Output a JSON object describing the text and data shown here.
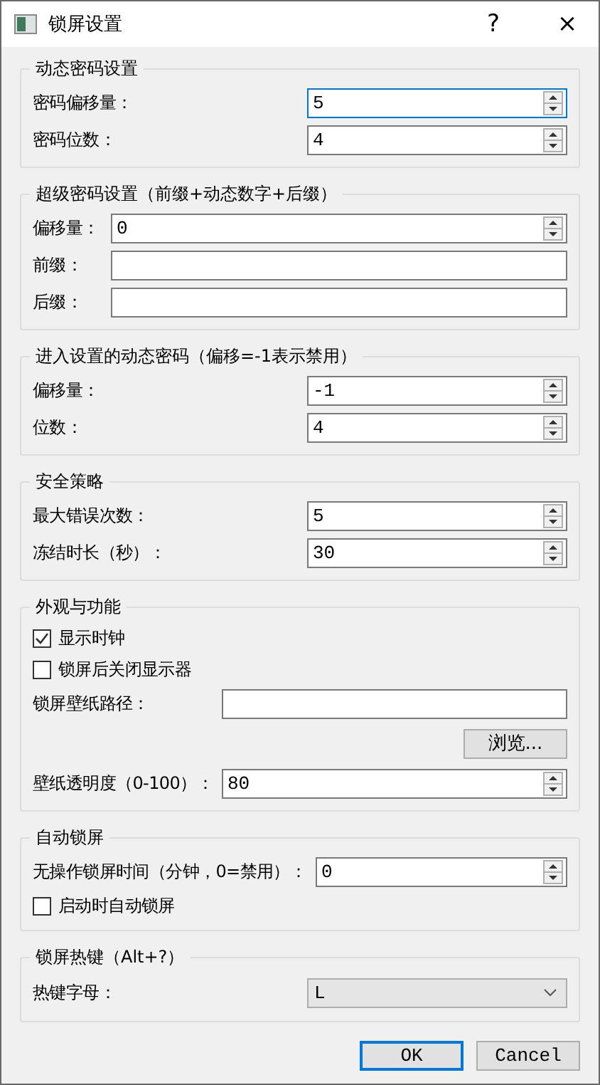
{
  "window": {
    "title": "锁屏设置",
    "help_button": "?",
    "close_button": "×"
  },
  "groups": [
    {
      "title": "动态密码设置",
      "rows": [
        {
          "kind": "spin",
          "label": "密码偏移量：",
          "value": "5",
          "focused": true
        },
        {
          "kind": "spin",
          "label": "密码位数：",
          "value": "4",
          "focused": false
        }
      ]
    },
    {
      "title": "超级密码设置（前缀+动态数字+后缀）",
      "rows": [
        {
          "kind": "spin",
          "label": "偏移量：",
          "value": "0",
          "focused": false
        },
        {
          "kind": "text",
          "label": "前缀："
        },
        {
          "kind": "text",
          "label": "后缀："
        }
      ]
    },
    {
      "title": "进入设置的动态密码（偏移=-1表示禁用）",
      "rows": [
        {
          "kind": "spin",
          "label": "偏移量：",
          "value": "-1",
          "focused": false
        },
        {
          "kind": "spin",
          "label": "位数：",
          "value": "4",
          "focused": false
        }
      ]
    },
    {
      "title": "安全策略",
      "rows": [
        {
          "kind": "spin",
          "label": "最大错误次数：",
          "value": "5",
          "focused": false
        },
        {
          "kind": "spin",
          "label": "冻结时长（秒）：",
          "value": "30",
          "focused": false
        }
      ]
    },
    {
      "title": "外观与功能",
      "rows": [
        {
          "kind": "checkbox",
          "label": "显示时钟",
          "checked": true
        },
        {
          "kind": "checkbox",
          "label": "锁屏后关闭显示器",
          "checked": false
        },
        {
          "kind": "text",
          "label": "锁屏壁纸路径："
        },
        {
          "kind": "button",
          "label": "浏览..."
        },
        {
          "kind": "spin",
          "label": "壁纸透明度（0-100）：",
          "value": "80",
          "focused": false
        }
      ]
    },
    {
      "title": "自动锁屏",
      "rows": [
        {
          "kind": "spin",
          "label": "无操作锁屏时间（分钟，0=禁用）：",
          "value": "0",
          "focused": false
        },
        {
          "kind": "checkbox",
          "label": "启动时自动锁屏",
          "checked": false
        }
      ]
    },
    {
      "title": "锁屏热键（Alt+?）",
      "rows": [
        {
          "kind": "combo",
          "label": "热键字母：",
          "value": "L"
        }
      ]
    }
  ],
  "buttons": [
    {
      "label": "OK",
      "default": true
    },
    {
      "label": "Cancel",
      "default": false
    }
  ]
}
